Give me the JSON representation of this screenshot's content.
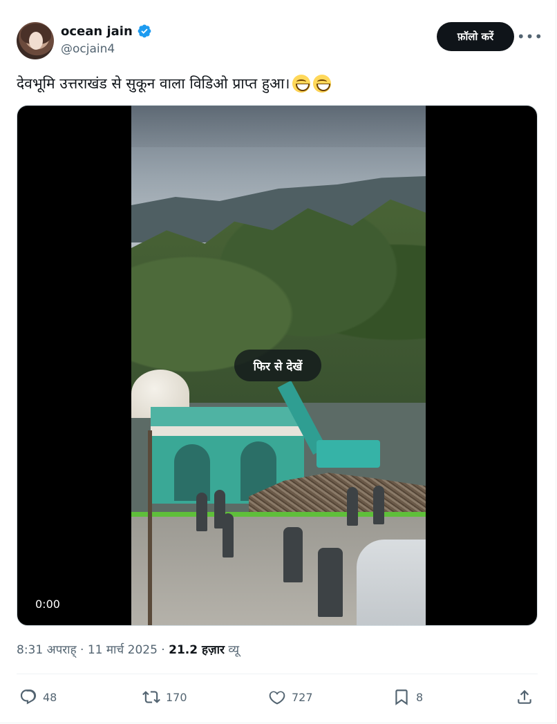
{
  "author": {
    "name": "ocean jain",
    "handle": "@ocjain4",
    "verified_icon": "verified-badge-icon",
    "accent_color": "#1d9bf0"
  },
  "header": {
    "follow_label": "फ़ॉलो करें",
    "more_label": "•••"
  },
  "post": {
    "text": "देवभूमि उत्तराखंड से सुकून वाला विडिओ प्राप्त हुआ।",
    "emojis": [
      "grinning-face-emoji",
      "grinning-face-emoji"
    ]
  },
  "media": {
    "replay_label": "फिर से देखें",
    "timer": "0:00"
  },
  "meta": {
    "time": "8:31 अपराह्",
    "separator": " · ",
    "date": "11 मार्च 2025",
    "views_count": "21.2 हज़ार",
    "views_label": "व्यू"
  },
  "actions": {
    "replies": "48",
    "reposts": "170",
    "likes": "727",
    "bookmarks": "8"
  }
}
